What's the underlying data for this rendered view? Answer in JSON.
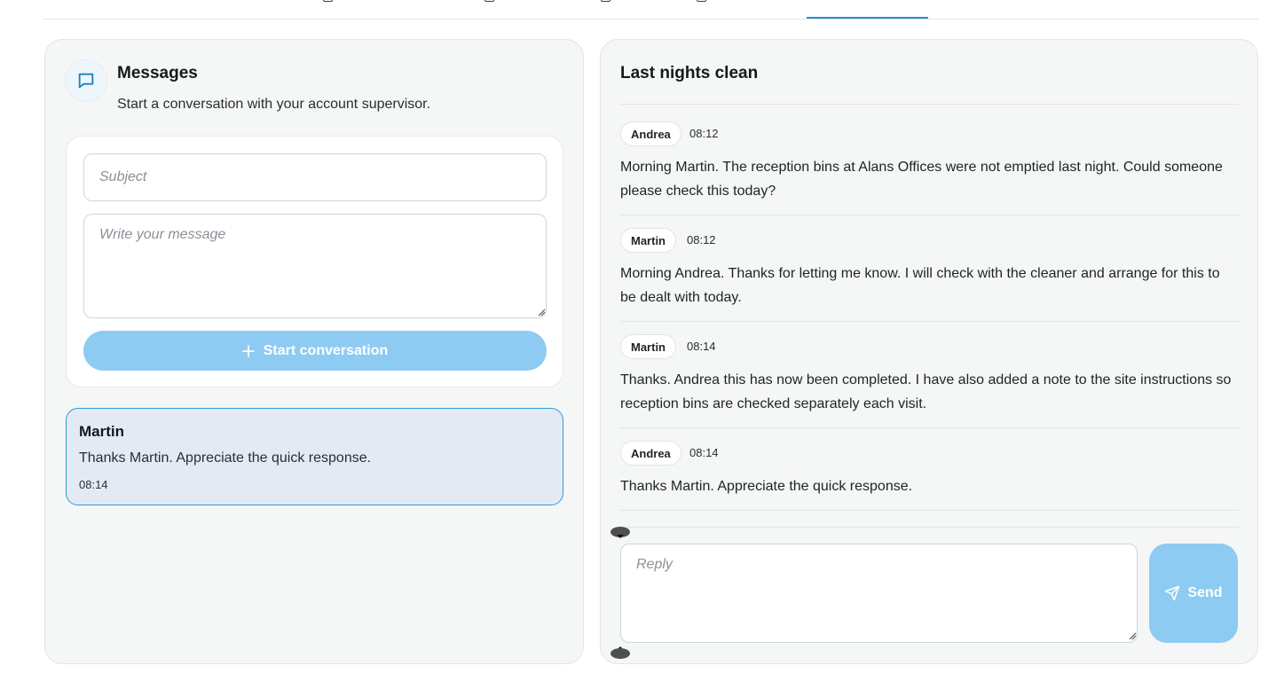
{
  "colors": {
    "accent": "#1d8fd8",
    "button_disabled": "#8ecbf3",
    "selected_card_bg": "#e4eaf4",
    "selected_card_border": "#2c9ad8",
    "panel_bg": "#f5f6f6"
  },
  "left_panel": {
    "icon": "chat-bubble-icon",
    "title": "Messages",
    "subtitle": "Start a conversation with your account supervisor.",
    "compose": {
      "subject_placeholder": "Subject",
      "message_placeholder": "Write your message",
      "start_icon": "plus-icon",
      "start_label": "Start conversation"
    },
    "conversations": [
      {
        "name": "Martin",
        "preview": "Thanks Martin. Appreciate the quick response.",
        "time": "08:14"
      }
    ]
  },
  "thread": {
    "title": "Last nights clean",
    "messages": [
      {
        "sender": "Andrea",
        "time": "08:12",
        "text": "Morning Martin. The reception bins at Alans Offices were not emptied last night. Could someone please check this today?"
      },
      {
        "sender": "Martin",
        "time": "08:12",
        "text": "Morning Andrea. Thanks for letting me know. I will check with the cleaner and arrange for this to be dealt with today."
      },
      {
        "sender": "Martin",
        "time": "08:14",
        "text": "Thanks. Andrea this has now been completed. I have also added a note to the site instructions so reception bins are checked separately each visit."
      },
      {
        "sender": "Andrea",
        "time": "08:14",
        "text": "Thanks Martin. Appreciate the quick response."
      }
    ],
    "reply_placeholder": "Reply",
    "send_icon": "send-icon",
    "send_label": "Send"
  }
}
